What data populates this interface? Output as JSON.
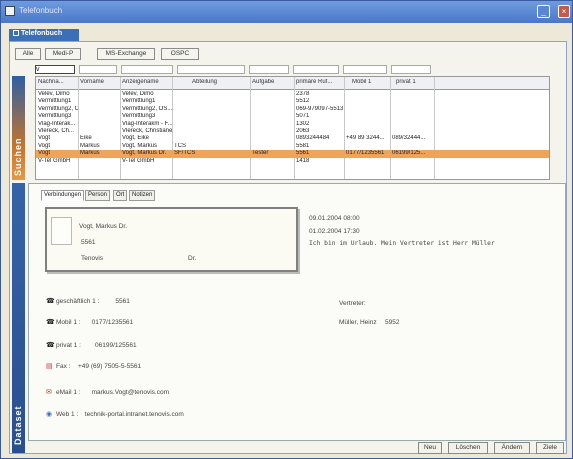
{
  "window": {
    "title": "Telefonbuch"
  },
  "app_tab": {
    "label": "Telefonbuch"
  },
  "filters": [
    "Alle",
    "Medi-P",
    "MS-Exchange",
    "OSPC"
  ],
  "search": {
    "value": "v"
  },
  "sidebar": {
    "top_label": "Suchen",
    "bottom_label": "Dataset"
  },
  "grid": {
    "columns": [
      "Nachna...",
      "Vorname",
      "Anzeigename",
      "Abteilung",
      "Aufgabe",
      "primäre Ruf...",
      "Mobil 1",
      "privat 1"
    ],
    "rows": [
      [
        "Velev, Dimo",
        "",
        "Velev, Dimo",
        "",
        "",
        "2378",
        "",
        ""
      ],
      [
        "Vermittlung1",
        "",
        "Vermittlung1",
        "",
        "",
        "5512",
        "",
        ""
      ],
      [
        "Vermittlung2, OSPC",
        "",
        "Vermittlung2, OS...",
        "",
        "",
        "069-979097-5513",
        "",
        ""
      ],
      [
        "Vermittlung3",
        "",
        "Vermittlung3",
        "",
        "",
        "5071",
        "",
        ""
      ],
      [
        "Vlag-Interak...",
        "",
        "Vlag-Interakm - F...",
        "",
        "",
        "1302",
        "",
        ""
      ],
      [
        "Vlereck, Ch...",
        "",
        "Vlereck, Christiane",
        "",
        "",
        "2063",
        "",
        ""
      ],
      [
        "Vogt",
        "Eike",
        "Vogt, Eike",
        "",
        "",
        "0893244484",
        "+49 89 3244...",
        "089/32444..."
      ],
      [
        "Vogt",
        "Markus",
        "Vogt, Markus",
        "TCS",
        "",
        "5581",
        "",
        ""
      ],
      [
        "Vogt",
        "Markus",
        "Vogt, Markus Dr.",
        "SF/TCS",
        "Tester",
        "5561",
        "0177/1235561",
        "06199/125..."
      ],
      [
        "V-Tel GmbH",
        "",
        "V-Tel GmbH",
        "",
        "",
        "1418",
        "",
        ""
      ]
    ],
    "selected_row_index": 8
  },
  "detail_tabs": [
    "Verbindungen",
    "Person",
    "Ort",
    "Notizen"
  ],
  "card": {
    "name": "Vogt, Markus Dr.",
    "extension": "5561",
    "company": "Tenovis",
    "title": "Dr."
  },
  "absence": {
    "from": "09.01.2004 08:00",
    "to": "01.02.2004 17:30",
    "message": "Ich bin im Urlaub. Mein Vertreter ist Herr Müller"
  },
  "contacts": [
    {
      "icon": "phone-icon",
      "label": "geschäftlich 1 :",
      "value": "5561"
    },
    {
      "icon": "mobile-icon",
      "label": "Mobil 1 :",
      "value": "0177/1235561"
    },
    {
      "icon": "phone-icon",
      "label": "privat 1 :",
      "value": "06199/125561"
    },
    {
      "icon": "fax-icon",
      "label": "Fax :",
      "value": "+49 (69) 7505-5-5561"
    },
    {
      "icon": "email-icon",
      "label": "eMail 1 :",
      "value": "markus.Vogt@tenovis.com"
    },
    {
      "icon": "web-icon",
      "label": "Web 1 :",
      "value": "technik-portal.intranet.tenovis.com"
    }
  ],
  "substitute": {
    "label": "Vertreter:",
    "name": "Müller, Heinz",
    "extension": "5952"
  },
  "buttons": [
    "Neu",
    "Löschen",
    "Ändern",
    "Ziele"
  ],
  "colors": {
    "accent": "#2d5fa3",
    "selected_row": "#f0a45a",
    "title_bar": "#5a88d6"
  }
}
